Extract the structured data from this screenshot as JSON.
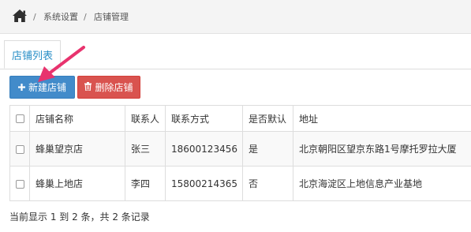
{
  "breadcrumb": {
    "home_icon": "home-icon",
    "separator": "/",
    "items": [
      "系统设置",
      "店铺管理"
    ]
  },
  "tabs": [
    {
      "label": "店铺列表",
      "active": true
    }
  ],
  "toolbar": {
    "new_label": "新建店铺",
    "new_icon": "plus-icon",
    "delete_label": "删除店铺",
    "delete_icon": "trash-icon"
  },
  "table": {
    "headers": [
      "店铺名称",
      "联系人",
      "联系方式",
      "是否默认",
      "地址"
    ],
    "rows": [
      {
        "name": "蜂巢望京店",
        "contact": "张三",
        "phone": "18600123456",
        "is_default": "是",
        "address": "北京朝阳区望京东路1号摩托罗拉大厦"
      },
      {
        "name": "蜂巢上地店",
        "contact": "李四",
        "phone": "15800214365",
        "is_default": "否",
        "address": "北京海淀区上地信息产业基地"
      }
    ]
  },
  "footer": {
    "pagination_text": "当前显示 1 到 2 条，共 2 条记录"
  },
  "colors": {
    "primary": "#428bca",
    "danger": "#d9534f",
    "tab_text": "#2a8fc7",
    "annotation_arrow": "#e8336e"
  }
}
